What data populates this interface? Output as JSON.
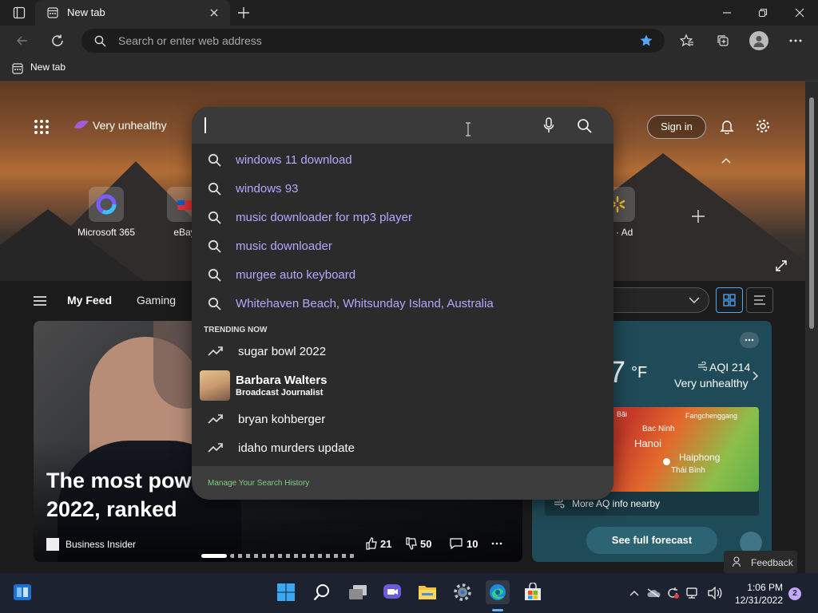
{
  "browser": {
    "tab_title": "New tab",
    "address_placeholder": "Search or enter web address",
    "favorites_item": "New tab"
  },
  "header": {
    "air_quality": "Very unhealthy",
    "sign_in": "Sign in"
  },
  "quick_links": [
    {
      "label": "Microsoft 365"
    },
    {
      "label": "eBay"
    },
    {
      "label": "art · Ad"
    }
  ],
  "feed_nav": {
    "items": [
      "My Feed",
      "Gaming"
    ]
  },
  "main_card": {
    "headline_line1": "The most pow",
    "headline_line2": "2022, ranked",
    "source": "Business Insider",
    "likes": "21",
    "dislikes": "50",
    "comments": "10"
  },
  "weather": {
    "temp": "7",
    "unit": "°F",
    "aqi": "AQI 214",
    "aqi_label": "Very unhealthy",
    "map_labels": [
      "Bãi",
      "Fangchenggang",
      "Bac Ninh",
      "Hanoi",
      "Haiphong",
      "Thái Bình"
    ],
    "more_aq": "More AQ info nearby",
    "forecast_button": "See full forecast",
    "feedback": "Feedback"
  },
  "search": {
    "suggestions": [
      "windows 11 download",
      "windows 93",
      "music downloader for mp3 player",
      "music downloader",
      "murgee auto keyboard",
      "Whitehaven Beach, Whitsunday Island, Australia"
    ],
    "trending_header": "TRENDING NOW",
    "trending": [
      {
        "text": "sugar bowl 2022"
      },
      {
        "text": "Barbara Walters",
        "subtitle": "Broadcast Journalist"
      },
      {
        "text": "bryan kohberger"
      },
      {
        "text": "idaho murders update"
      }
    ],
    "manage_history": "Manage Your Search History"
  },
  "taskbar": {
    "time": "1:06 PM",
    "date": "12/31/2022",
    "notification_count": "2"
  }
}
